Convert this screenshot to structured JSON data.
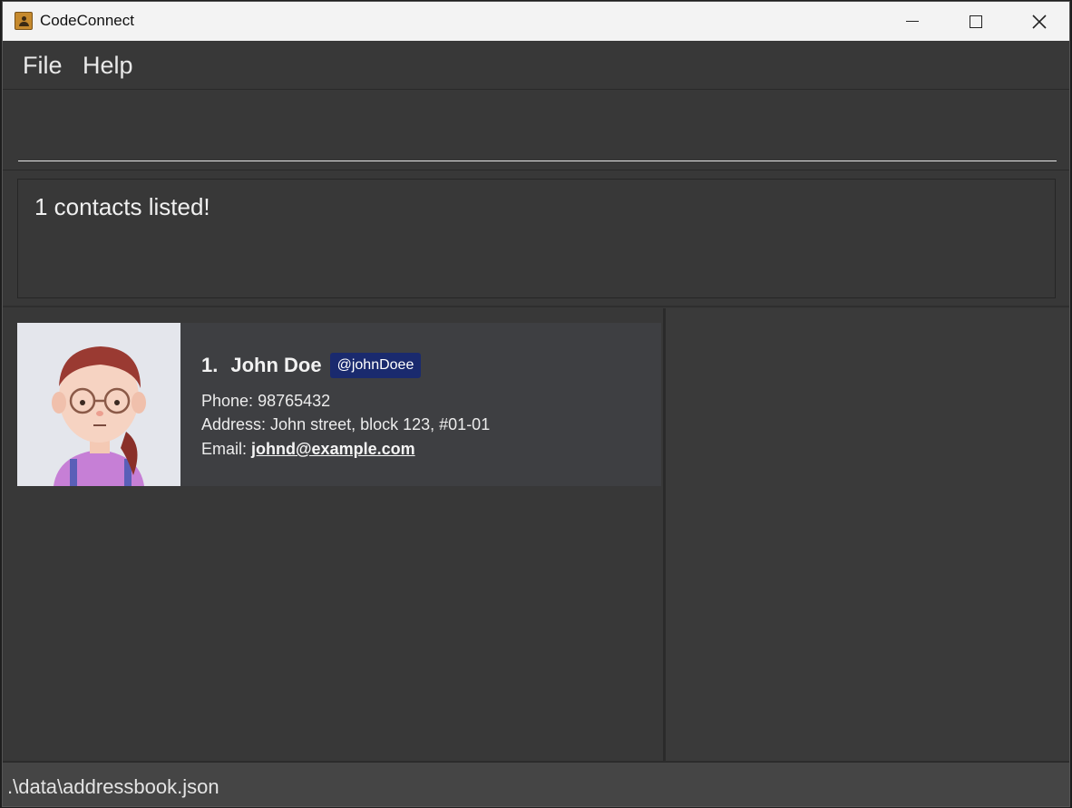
{
  "window": {
    "title": "CodeConnect"
  },
  "menu": {
    "file": "File",
    "help": "Help"
  },
  "command": {
    "value": "",
    "placeholder": ""
  },
  "result": {
    "message": "1 contacts listed!"
  },
  "contacts": [
    {
      "index": "1.",
      "name": "John Doe",
      "handle": "@johnDoee",
      "phone_label": "Phone: ",
      "phone": "98765432",
      "address_label": "Address: ",
      "address": "John street, block 123, #01-01",
      "email_label": "Email: ",
      "email": "johnd@example.com"
    }
  ],
  "status": {
    "file_path": ".\\data\\addressbook.json"
  },
  "colors": {
    "handle_badge": "#1a2a6e",
    "background": "#383838"
  },
  "icons": {
    "app": "contact-book-icon",
    "minimize": "minimize-icon",
    "maximize": "maximize-icon",
    "close": "close-icon"
  }
}
